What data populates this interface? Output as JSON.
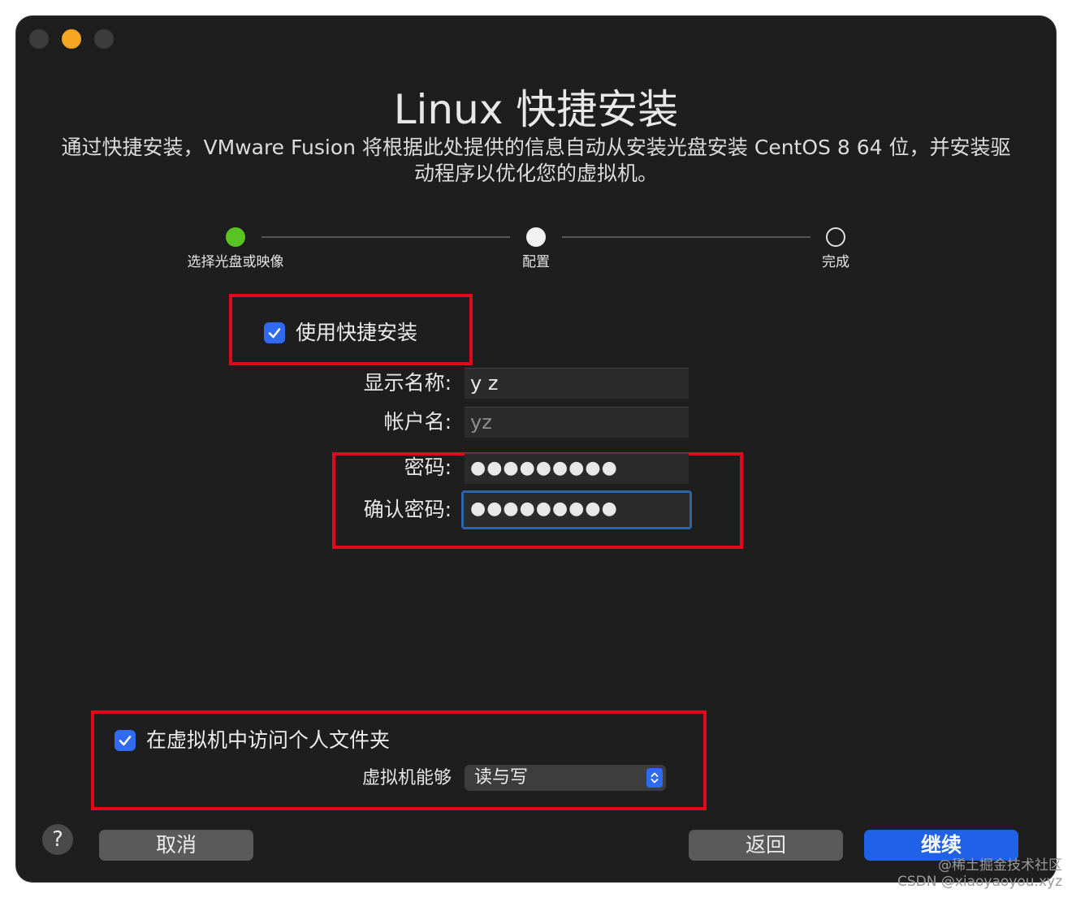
{
  "header": {
    "title": "Linux 快捷安装",
    "description": "通过快捷安装，VMware Fusion 将根据此处提供的信息自动从安装光盘安装 CentOS 8 64 位，并安装驱动程序以优化您的虚拟机。"
  },
  "steps": [
    {
      "label": "选择光盘或映像",
      "state": "completed",
      "color": "#58c322"
    },
    {
      "label": "配置",
      "state": "current"
    },
    {
      "label": "完成",
      "state": "pending"
    }
  ],
  "easy_install": {
    "label": "使用快捷安装",
    "checked": true
  },
  "form": {
    "display_name": {
      "label": "显示名称:",
      "value": "y z"
    },
    "account_name": {
      "label": "帐户名:",
      "value": "yz"
    },
    "password": {
      "label": "密码:",
      "value": "●●●●●●●●●"
    },
    "confirm_password": {
      "label": "确认密码:",
      "value": "●●●●●●●●●"
    }
  },
  "sharing": {
    "label": "在虚拟机中访问个人文件夹",
    "checked": true,
    "vm_can_label": "虚拟机能够",
    "vm_can_value": "读与写"
  },
  "buttons": {
    "help": "?",
    "cancel": "取消",
    "back": "返回",
    "continue": "继续"
  },
  "watermark": {
    "line1": "@稀土掘金技术社区",
    "line2": "CSDN @xiaoyaoyou.xyz"
  },
  "colors": {
    "accent": "#2f6bf0",
    "highlight_box": "#e0081a",
    "window_bg": "#1e1e1e"
  }
}
